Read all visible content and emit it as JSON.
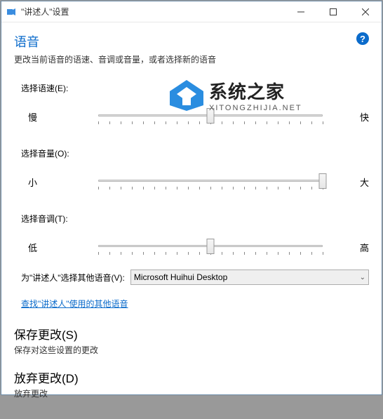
{
  "titlebar": {
    "title": "\"讲述人\"设置"
  },
  "help_tooltip": "?",
  "section": {
    "title": "语音",
    "subtitle": "更改当前语音的语速、音调或音量，或者选择新的语音"
  },
  "speed": {
    "label": "选择语速(E):",
    "min_label": "慢",
    "max_label": "快",
    "value": 50
  },
  "volume": {
    "label": "选择音量(O):",
    "min_label": "小",
    "max_label": "大",
    "value": 100
  },
  "pitch": {
    "label": "选择音调(T):",
    "min_label": "低",
    "max_label": "高",
    "value": 50
  },
  "voice_select": {
    "label": "为\"讲述人\"选择其他语音(V):",
    "selected": "Microsoft Huihui Desktop"
  },
  "link": {
    "text": "查找\"讲述人\"使用的其他语音"
  },
  "save": {
    "title": "保存更改(S)",
    "sub": "保存对这些设置的更改"
  },
  "discard": {
    "title": "放弃更改(D)",
    "sub": "放弃更改"
  },
  "watermark": {
    "main": "系统之家",
    "sub": "XITONGZHIJIA.NET"
  }
}
